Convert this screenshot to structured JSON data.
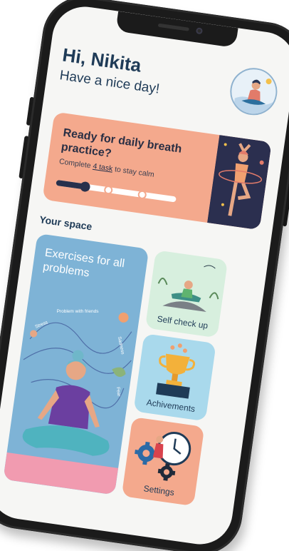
{
  "header": {
    "greeting": "Hi, Nikita",
    "subtitle": "Have a nice day!"
  },
  "banner": {
    "title": "Ready for daily breath practice?",
    "text_prefix": "Complete",
    "task_link": "4 task",
    "text_suffix": "to stay calm",
    "progress": 0.2,
    "progress_steps": 4
  },
  "section": {
    "title": "Your space"
  },
  "cards": {
    "exercises": {
      "label": "Exercises for all problems",
      "tags": [
        "Stress",
        "Problem with friends",
        "Sadness",
        "Fear"
      ]
    },
    "self_check": {
      "label": "Self check up"
    },
    "achievements": {
      "label": "Achivements"
    },
    "settings": {
      "label": "Settings"
    }
  },
  "colors": {
    "navy": "#1f3b57",
    "peach": "#f4a98d",
    "blue": "#7eb3d6",
    "mint": "#d7efde",
    "sky": "#a9d9ec",
    "screen_bg": "#f6f6f4"
  }
}
